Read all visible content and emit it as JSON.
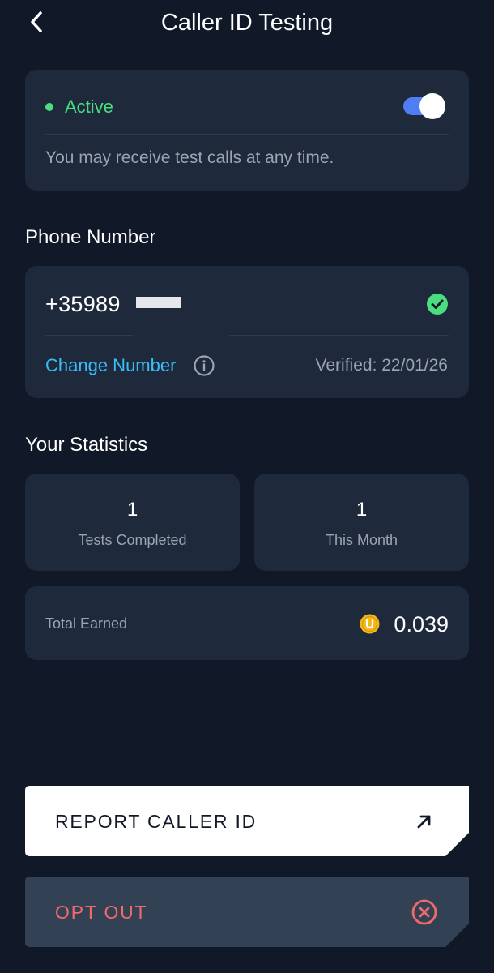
{
  "header": {
    "title": "Caller ID Testing",
    "back_icon": "chevron-left-icon"
  },
  "status": {
    "label": "Active",
    "toggle_on": true,
    "description": "You may receive test calls at any time.",
    "color": "#4ade80",
    "toggle_color": "#4f7df3"
  },
  "phone": {
    "section_title": "Phone Number",
    "number_visible": "+35989",
    "verified_icon": "check-circle-icon",
    "change_label": "Change Number",
    "info_icon": "info-icon",
    "verified_text": "Verified: 22/01/26",
    "link_color": "#38bdf8"
  },
  "statistics": {
    "section_title": "Your Statistics",
    "tests_completed": {
      "value": "1",
      "label": "Tests Completed"
    },
    "this_month": {
      "value": "1",
      "label": "This Month"
    },
    "total_earned": {
      "label": "Total Earned",
      "value": "0.039",
      "coin_icon": "coin-icon"
    }
  },
  "actions": {
    "report": {
      "label": "REPORT CALLER ID",
      "icon": "arrow-up-right-icon"
    },
    "opt_out": {
      "label": "OPT OUT",
      "icon": "close-circle-icon",
      "color": "#f06a6a"
    }
  }
}
